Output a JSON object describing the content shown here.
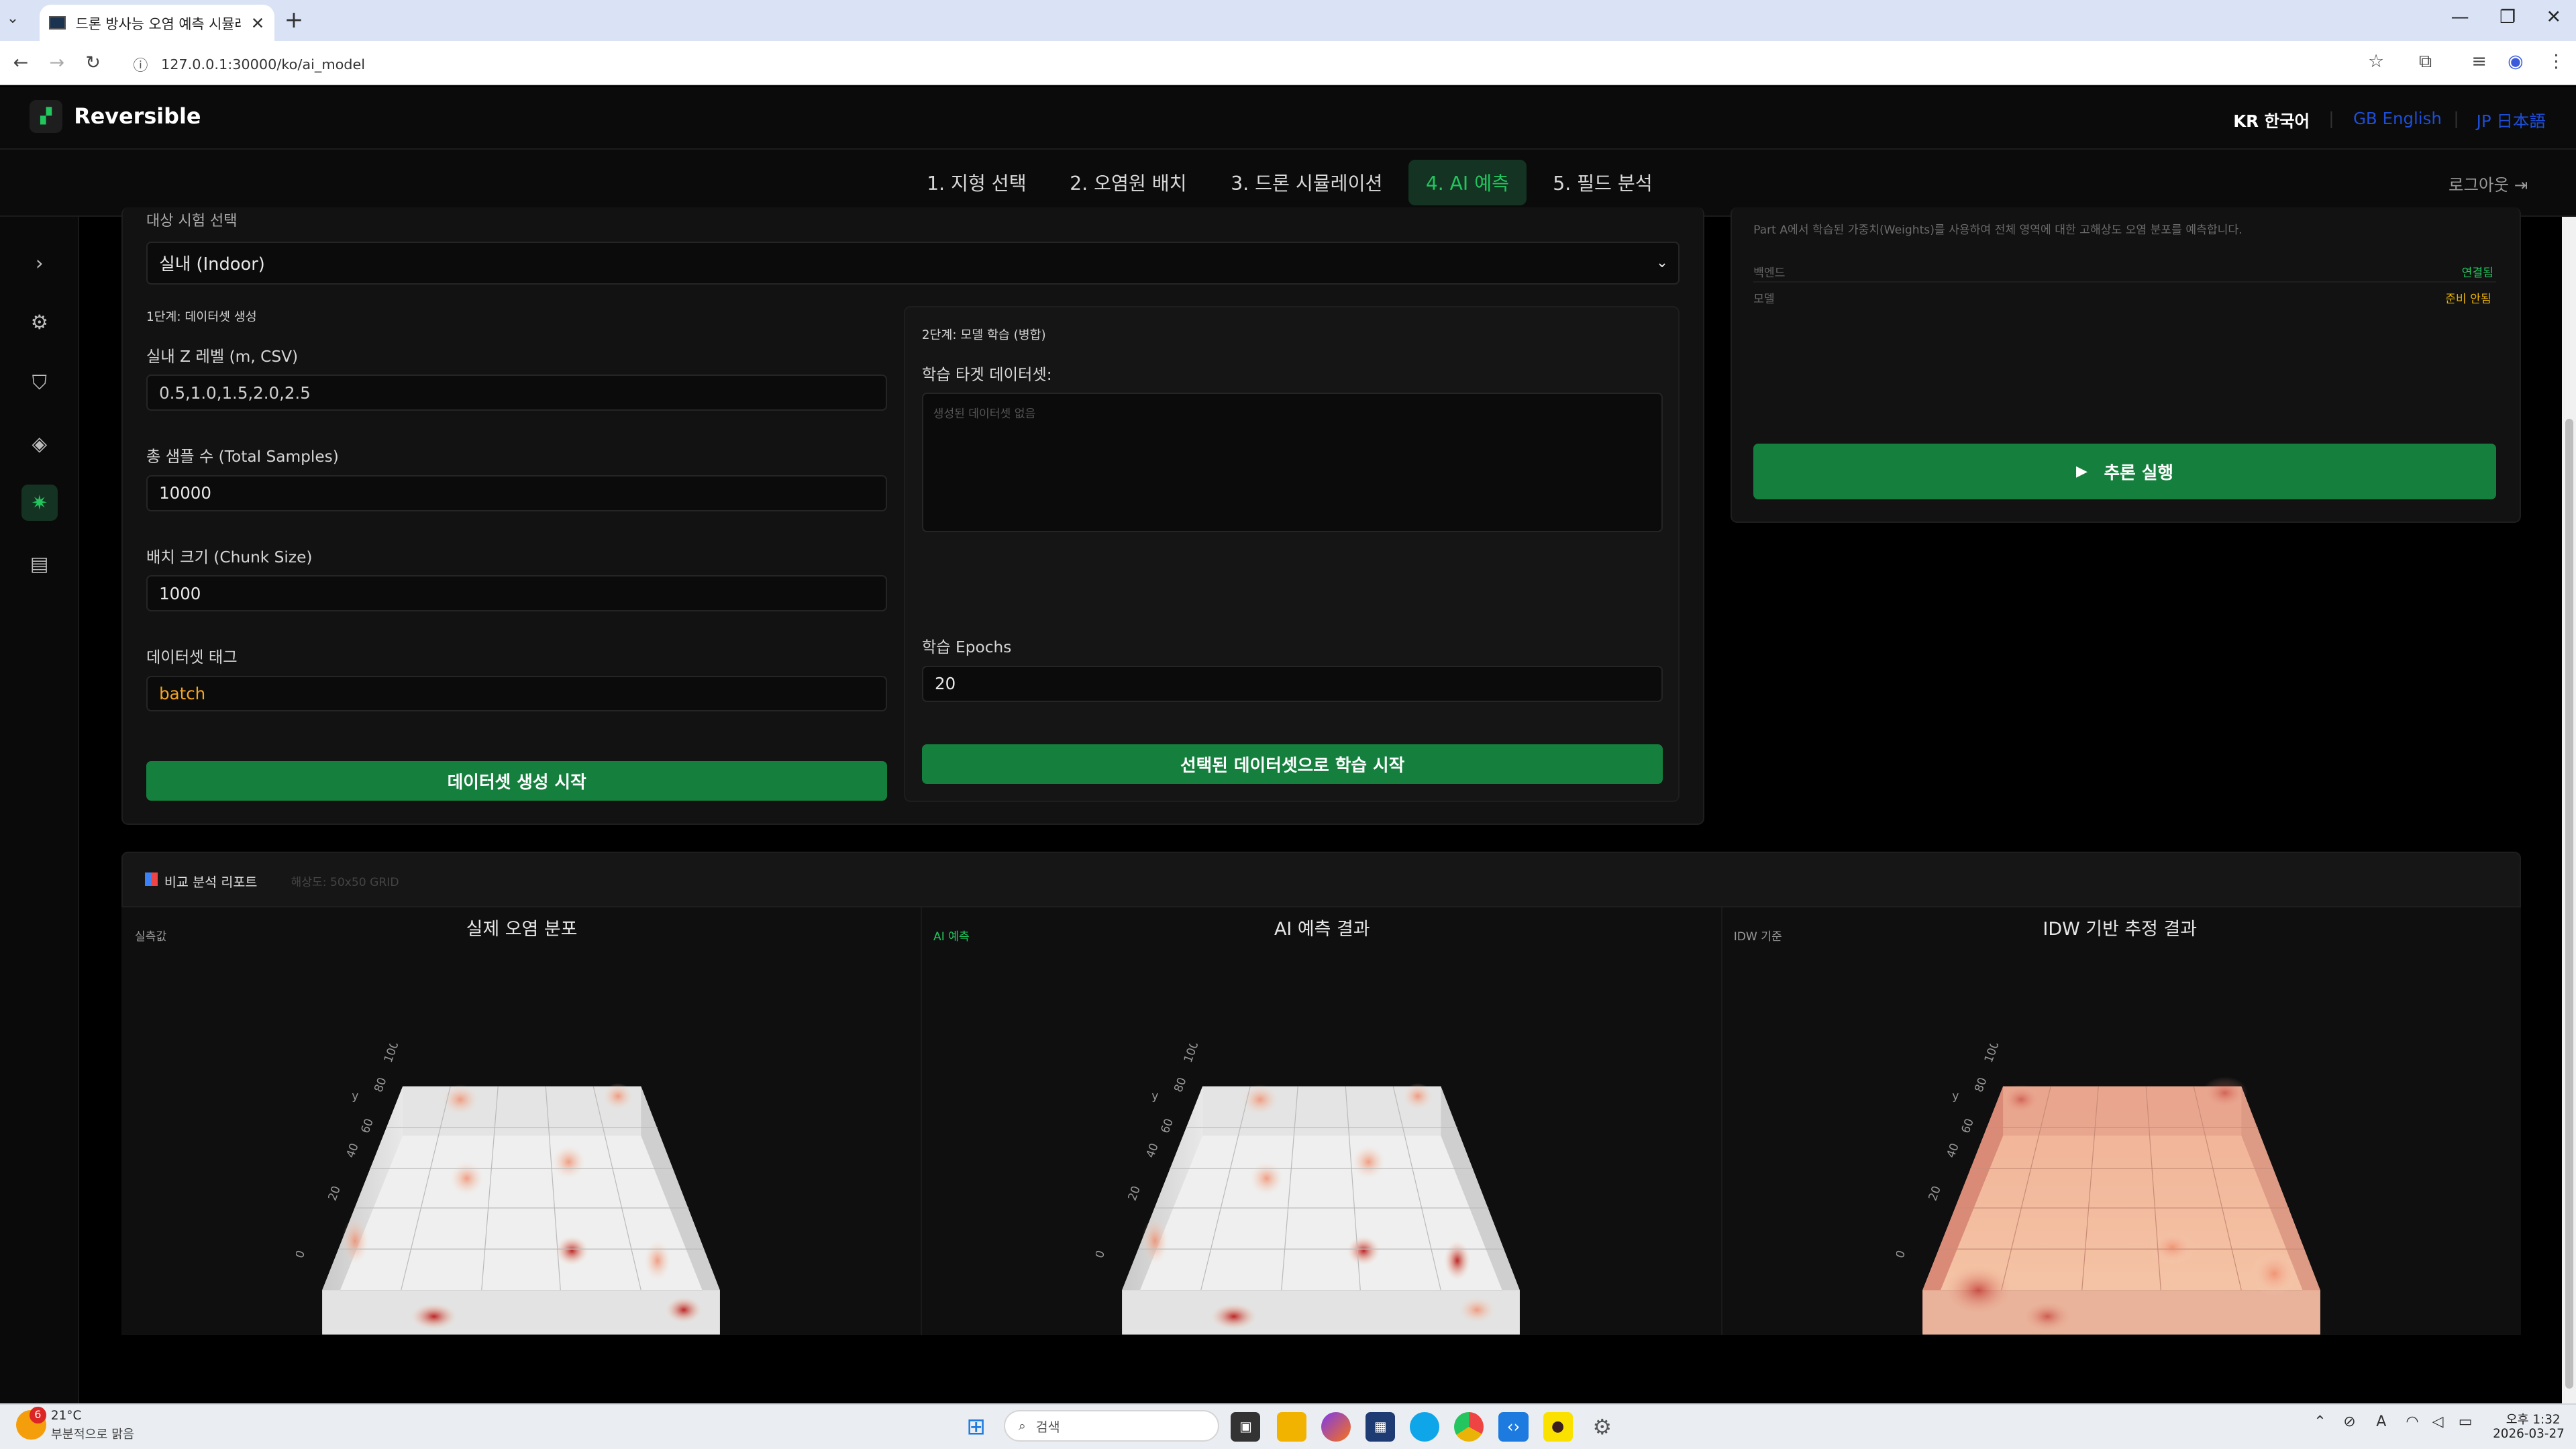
{
  "browser": {
    "tab_title": "드론 방사능 오염 예측 시뮬레이",
    "url": "127.0.0.1:30000/ko/ai_model"
  },
  "app": {
    "brand": "Reversible",
    "languages": [
      "KR 한국어",
      "GB English",
      "JP 日本語"
    ],
    "nav": [
      "1. 지형 선택",
      "2. 오염원 배치",
      "3. 드론 시뮬레이션",
      "4. AI 예측",
      "5. 필드 분석"
    ],
    "logout": "로그아웃"
  },
  "env": {
    "label": "대상 시험 선택",
    "selected": "실내 (Indoor)"
  },
  "step1": {
    "title": "1단계: 데이터셋 생성",
    "z_levels_label": "실내 Z 레벨 (m, CSV)",
    "z_levels_value": "0.5,1.0,1.5,2.0,2.5",
    "total_samples_label": "총 샘플 수 (Total Samples)",
    "total_samples_value": "10000",
    "chunk_label": "배치 크기 (Chunk Size)",
    "chunk_value": "1000",
    "tag_label": "데이터셋 태그",
    "tag_value": "batch",
    "button": "데이터셋 생성 시작"
  },
  "step2": {
    "title": "2단계: 모델 학습 (병합)",
    "target_label": "학습 타겟 데이터셋:",
    "target_placeholder": "생성된 데이터셋 없음",
    "epochs_label": "학습 Epochs",
    "epochs_value": "20",
    "button": "선택된 데이터셋으로 학습 시작"
  },
  "inference": {
    "description": "Part A에서 학습된 가중치(Weights)를 사용하여 전체 영역에 대한 고해상도 오염 분포를 예측합니다.",
    "rows": [
      {
        "key": "백엔드",
        "value": "연결됨",
        "color": "#22c55e"
      },
      {
        "key": "모델",
        "value": "준비 안됨",
        "color": "#eab308"
      }
    ],
    "button": "추론 실행"
  },
  "report": {
    "title": "비교 분석 리포트",
    "subtitle": "해상도: 50x50 GRID",
    "panels": [
      {
        "tag": "실측값",
        "title": "실제 오염 분포",
        "tag_color": "#999999"
      },
      {
        "tag": "AI 예측",
        "title": "AI 예측 결과",
        "tag_color": "#22c55e"
      },
      {
        "tag": "IDW 기준",
        "title": "IDW 기반 추정 결과",
        "tag_color": "#999999"
      }
    ],
    "axis_ticks": [
      "0",
      "20",
      "40",
      "60",
      "80",
      "100"
    ],
    "axis_y_label": "y"
  },
  "taskbar": {
    "weather_temp": "21°C",
    "weather_desc": "부분적으로 맑음",
    "weather_badge": "6",
    "search": "검색",
    "time": "오후 1:32",
    "date": "2026-03-27"
  }
}
